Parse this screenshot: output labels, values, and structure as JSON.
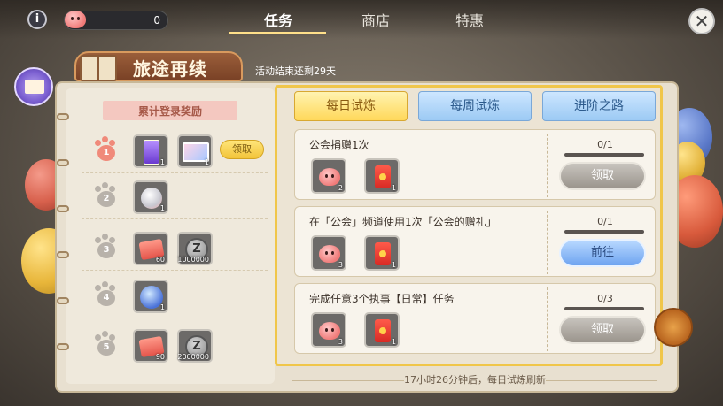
{
  "header": {
    "info_icon": "info-icon",
    "currency": {
      "icon": "poring-icon",
      "value": "0"
    },
    "tabs": [
      {
        "label": "任务",
        "active": true
      },
      {
        "label": "商店",
        "active": false
      },
      {
        "label": "特惠",
        "active": false
      }
    ],
    "close_icon": "close-icon"
  },
  "banner": {
    "title": "旅途再续",
    "countdown": "活动结束还剩29天"
  },
  "login_rewards": {
    "title": "累计登录奖励",
    "days": [
      {
        "day": "1",
        "rewards": [
          {
            "icon": "purple-card-icon",
            "count": "1"
          },
          {
            "icon": "photo-icon",
            "count": "1"
          }
        ],
        "claim_label": "领取"
      },
      {
        "day": "2",
        "rewards": [
          {
            "icon": "silver-poring-icon",
            "count": "1"
          }
        ]
      },
      {
        "day": "3",
        "rewards": [
          {
            "icon": "ticket-icon",
            "count": "60"
          },
          {
            "icon": "zeny-icon",
            "count": "1000000"
          }
        ]
      },
      {
        "day": "4",
        "rewards": [
          {
            "icon": "blue-orb-icon",
            "count": "1"
          }
        ]
      },
      {
        "day": "5",
        "rewards": [
          {
            "icon": "ticket-icon",
            "count": "90"
          },
          {
            "icon": "zeny-icon",
            "count": "2000000"
          }
        ]
      }
    ]
  },
  "sub_tabs": [
    {
      "label": "每日试炼",
      "active": true
    },
    {
      "label": "每周试炼",
      "active": false
    },
    {
      "label": "进阶之路",
      "active": false
    }
  ],
  "tasks": [
    {
      "name": "公会捐赠1次",
      "rewards": [
        {
          "icon": "poring-icon",
          "count": "2"
        },
        {
          "icon": "red-envelope-icon",
          "count": "1"
        }
      ],
      "progress": "0/1",
      "button": "领取",
      "button_style": "disabled"
    },
    {
      "name": "在「公会」频道使用1次「公会的赠礼」",
      "rewards": [
        {
          "icon": "poring-icon",
          "count": "3"
        },
        {
          "icon": "red-envelope-icon",
          "count": "1"
        }
      ],
      "progress": "0/1",
      "button": "前往",
      "button_style": "go"
    },
    {
      "name": "完成任意3个执事【日常】任务",
      "rewards": [
        {
          "icon": "poring-icon",
          "count": "3"
        },
        {
          "icon": "red-envelope-icon",
          "count": "1"
        }
      ],
      "progress": "0/3",
      "button": "领取",
      "button_style": "disabled"
    }
  ],
  "footer": "17小时26分钟后，每日试炼刷新"
}
